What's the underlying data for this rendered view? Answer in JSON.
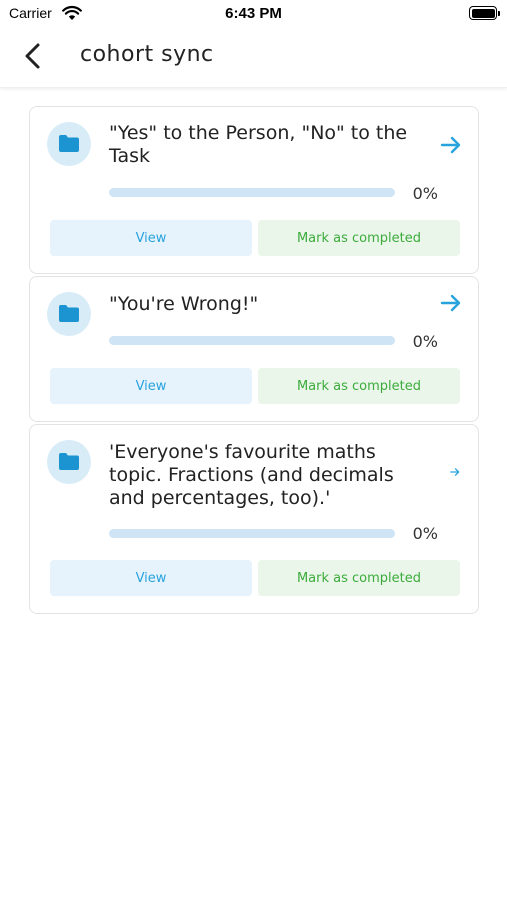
{
  "status_bar": {
    "carrier": "Carrier",
    "time": "6:43 PM",
    "wifi_icon": "wifi-icon",
    "battery_icon": "battery-icon"
  },
  "nav": {
    "title": "cohort sync",
    "back_icon": "chevron-left-icon"
  },
  "colors": {
    "accent_blue": "#29a3dd",
    "light_blue": "#e6f3fc",
    "progress_track": "#cfe5f5",
    "accent_green": "#3cab3c",
    "light_green": "#eaf6ea"
  },
  "cards": [
    {
      "title": "\"Yes\" to the Person, \"No\" to the Task",
      "progress_label": "0%",
      "progress": 0,
      "view_label": "View",
      "complete_label": "Mark as completed",
      "icon": "folder-icon",
      "arrow_icon": "arrow-right-icon"
    },
    {
      "title": "\"You're Wrong!\"",
      "progress_label": "0%",
      "progress": 0,
      "view_label": "View",
      "complete_label": "Mark as completed",
      "icon": "folder-icon",
      "arrow_icon": "arrow-right-icon"
    },
    {
      "title": "'Everyone's favourite maths topic. Fractions (and decimals and percentages, too).'",
      "progress_label": "0%",
      "progress": 0,
      "view_label": "View",
      "complete_label": "Mark as completed",
      "icon": "folder-icon",
      "arrow_icon": "arrow-right-icon"
    }
  ]
}
